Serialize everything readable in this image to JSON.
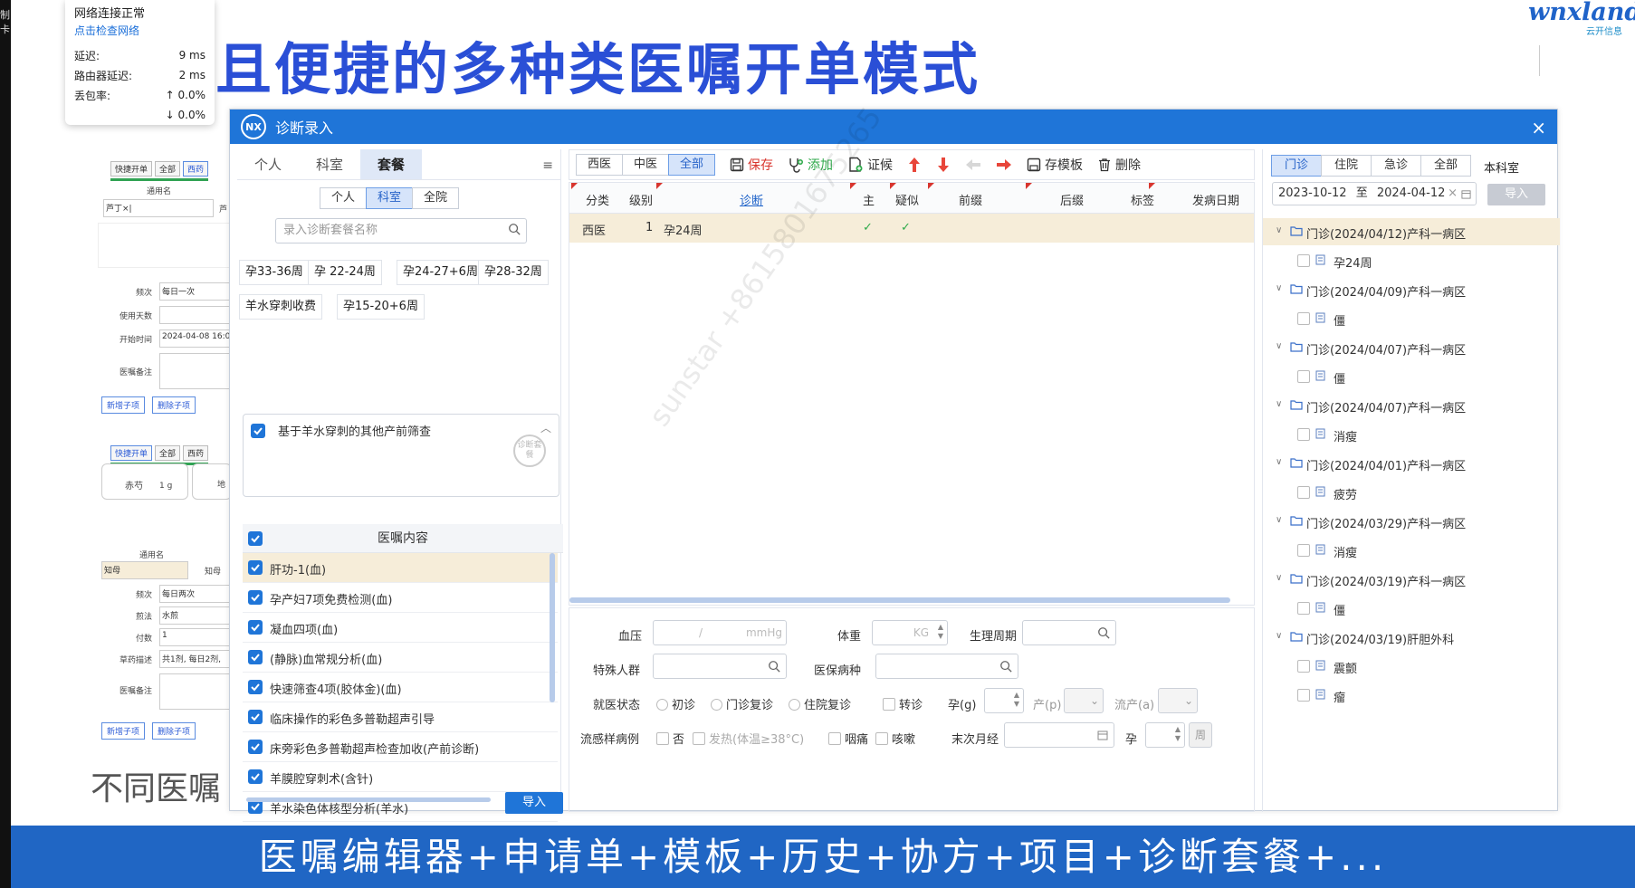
{
  "banner": {
    "title": "且便捷的多种类医嘱开单模式",
    "bottom_text": "医嘱编辑器+申请单+模板+历史+协方+项目+诊断套餐+...",
    "left_caption": "不同医嘱"
  },
  "logo": {
    "word": "wnxland",
    "sub": "云开信息"
  },
  "left_strip": {
    "text": "制卡"
  },
  "network": {
    "status": "网络连接正常",
    "check_link": "点击检查网络",
    "rows": [
      {
        "label": "延迟:",
        "value": "9 ms"
      },
      {
        "label": "路由器延迟:",
        "value": "2 ms"
      },
      {
        "label": "丢包率:",
        "value": "↑ 0.0%"
      },
      {
        "label": "",
        "value": "↓ 0.0%"
      }
    ]
  },
  "bg_form": {
    "tabs_a": [
      "快捷开单",
      "全部",
      "西药"
    ],
    "tabs_b": [
      "快捷开单",
      "全部",
      "西药"
    ],
    "generic": "通用名",
    "input_val": "芦丁×|",
    "freq_label": "频次",
    "freq_val": "每日一次",
    "days_label": "使用天数",
    "start_label": "开始时间",
    "start_val": "2024-04-08 16:00:",
    "note_label": "医嘱备注",
    "add_child": "新增子项",
    "del_child": "删除子项",
    "herb1": "赤芍",
    "herb1_qty": "1 g",
    "herb2": "地",
    "generic2": "通用名",
    "zhimu": "知母",
    "zhimu2": "知母",
    "freq2_label": "频次",
    "freq2_val": "每日两次",
    "method_label": "煎法",
    "method_val": "水煎",
    "doses_label": "付数",
    "doses_val": "1",
    "desc_label": "草药描述",
    "desc_val": "共1剂, 每日2剂,",
    "note2_label": "医嘱备注",
    "add_child2": "新增子项",
    "del_child2": "删除子项",
    "left_clip": "芦"
  },
  "window": {
    "logo": "NX",
    "title": "诊断录入",
    "close": "×"
  },
  "left_pane": {
    "tabs": [
      "个人",
      "科室",
      "套餐"
    ],
    "active_tab": 2,
    "menu_icon": "≡",
    "scope": [
      "个人",
      "科室",
      "全院"
    ],
    "scope_active": 1,
    "search_placeholder": "录入诊断套餐名称",
    "chips": [
      "孕33-36周",
      "孕 22-24周",
      "孕24-27+6周",
      "孕28-32周",
      "羊水穿刺收费",
      "孕15-20+6周"
    ],
    "package_name": "基于羊水穿刺的其他产前筛查",
    "stamp_text": "诊断套餐",
    "list_header": "医嘱内容",
    "items": [
      "肝功-1(血)",
      "孕产妇7项免费检测(血)",
      "凝血四项(血)",
      "(静脉)血常规分析(血)",
      "快速筛查4项(胶体金)(血)",
      "临床操作的彩色多普勒超声引导",
      "床旁彩色多普勒超声检查加收(产前诊断)",
      "羊膜腔穿刺术(含针)",
      "羊水染色体核型分析(羊水)"
    ],
    "import_btn": "导入"
  },
  "toolbar": {
    "filters": [
      "西医",
      "中医",
      "全部"
    ],
    "filter_active": 2,
    "save": "保存",
    "add": "添加",
    "syndrome": "证候",
    "save_template": "存模板",
    "delete": "删除"
  },
  "grid": {
    "columns": [
      "分类",
      "级别",
      "诊断",
      "主",
      "疑似",
      "前缀",
      "后缀",
      "标签",
      "发病日期"
    ],
    "rows": [
      {
        "category": "西医",
        "level": "1",
        "diagnosis": "孕24周",
        "main": "✓",
        "suspect": "✓"
      }
    ]
  },
  "watermark": "sunstar +8615801675265",
  "form": {
    "bp_label": "血压",
    "bp_sep": "/",
    "bp_unit": "mmHg",
    "weight_label": "体重",
    "weight_unit": "KG",
    "cycle_label": "生理周期",
    "special_label": "特殊人群",
    "insurance_label": "医保病种",
    "visit_label": "就医状态",
    "visit_opts": [
      "初诊",
      "门诊复诊",
      "住院复诊"
    ],
    "transfer": "转诊",
    "g_label": "孕(g)",
    "p_label": "产(p)",
    "a_label": "流产(a)",
    "epi_label": "流感样病例",
    "epi_opts": [
      "否",
      "发热(体温≥38°C)",
      "咽痛",
      "咳嗽"
    ],
    "lmp_label": "末次月经",
    "preg_label": "孕",
    "week_btn": "周"
  },
  "right_pane": {
    "tabs": [
      "门诊",
      "住院",
      "急诊",
      "全部"
    ],
    "tab_active": 0,
    "dept": "本科室",
    "date_from": "2023-10-12",
    "date_to_sep": "至",
    "date_to": "2024-04-12",
    "clear": "×",
    "import_btn": "导入",
    "history": [
      {
        "visit": "门诊(2024/04/12)产科一病区",
        "dx": "孕24周"
      },
      {
        "visit": "门诊(2024/04/09)产科一病区",
        "dx": "僵"
      },
      {
        "visit": "门诊(2024/04/07)产科一病区",
        "dx": "僵"
      },
      {
        "visit": "门诊(2024/04/07)产科一病区",
        "dx": "消瘦"
      },
      {
        "visit": "门诊(2024/04/01)产科一病区",
        "dx": "疲劳"
      },
      {
        "visit": "门诊(2024/03/29)产科一病区",
        "dx": "消瘦"
      },
      {
        "visit": "门诊(2024/03/19)产科一病区",
        "dx": "僵"
      },
      {
        "visit": "门诊(2024/03/19)肝胆外科",
        "dx": "震颤"
      }
    ],
    "extra_leaf": "瘤"
  }
}
